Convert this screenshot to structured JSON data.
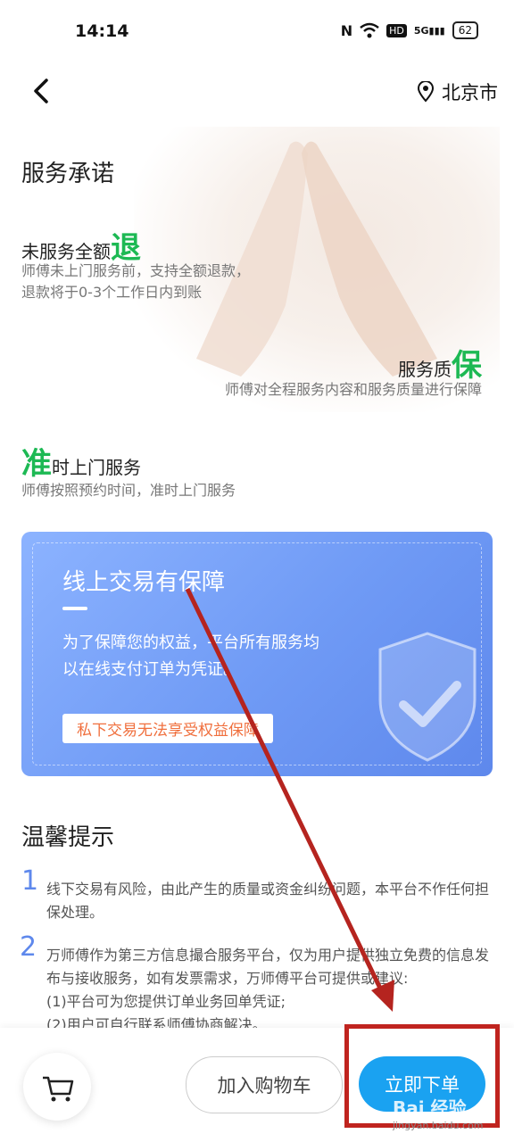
{
  "status_bar": {
    "time": "14:14",
    "battery": "62",
    "network": "5G",
    "hd": "HD"
  },
  "topbar": {
    "location": "北京市"
  },
  "promise": {
    "title": "服务承诺",
    "refund": {
      "title": "未服务全额",
      "highlight": "退",
      "desc1": "师傅未上门服务前，支持全额退款，",
      "desc2": "退款将于0-3个工作日内到账"
    },
    "quality": {
      "title": "服务质",
      "highlight": "保",
      "desc": "师傅对全程服务内容和服务质量进行保障"
    },
    "ontime": {
      "highlight": "准",
      "title": "时上门服务",
      "desc": "师傅按照预约时间，准时上门服务"
    }
  },
  "card": {
    "title": "线上交易有保障",
    "desc": "为了保障您的权益，平台所有服务均以在线支付订单为凭证。",
    "badge": "私下交易无法享受权益保障"
  },
  "tips": {
    "title": "温馨提示",
    "items": [
      {
        "num": "1",
        "text": "线下交易有风险，由此产生的质量或资金纠纷问题，本平台不作任何担保处理。"
      },
      {
        "num": "2",
        "text": "万师傅作为第三方信息撮合服务平台，仅为用户提供独立免费的信息发布与接收服务，如有发票需求，万师傅平台可提供或建议:",
        "line3": "(1)平台可为您提供订单业务回单凭证;",
        "line4": "(2)用户可自行联系师傅协商解决。"
      }
    ]
  },
  "bottom": {
    "add_cart": "加入购物车",
    "order": "立即下单"
  },
  "watermark": {
    "brand": "Bai 经验",
    "url": "jingyan.baidu.com"
  },
  "colors": {
    "green": "#1db954",
    "blue": "#1aa2f1",
    "annotation_red": "#c0241f"
  }
}
